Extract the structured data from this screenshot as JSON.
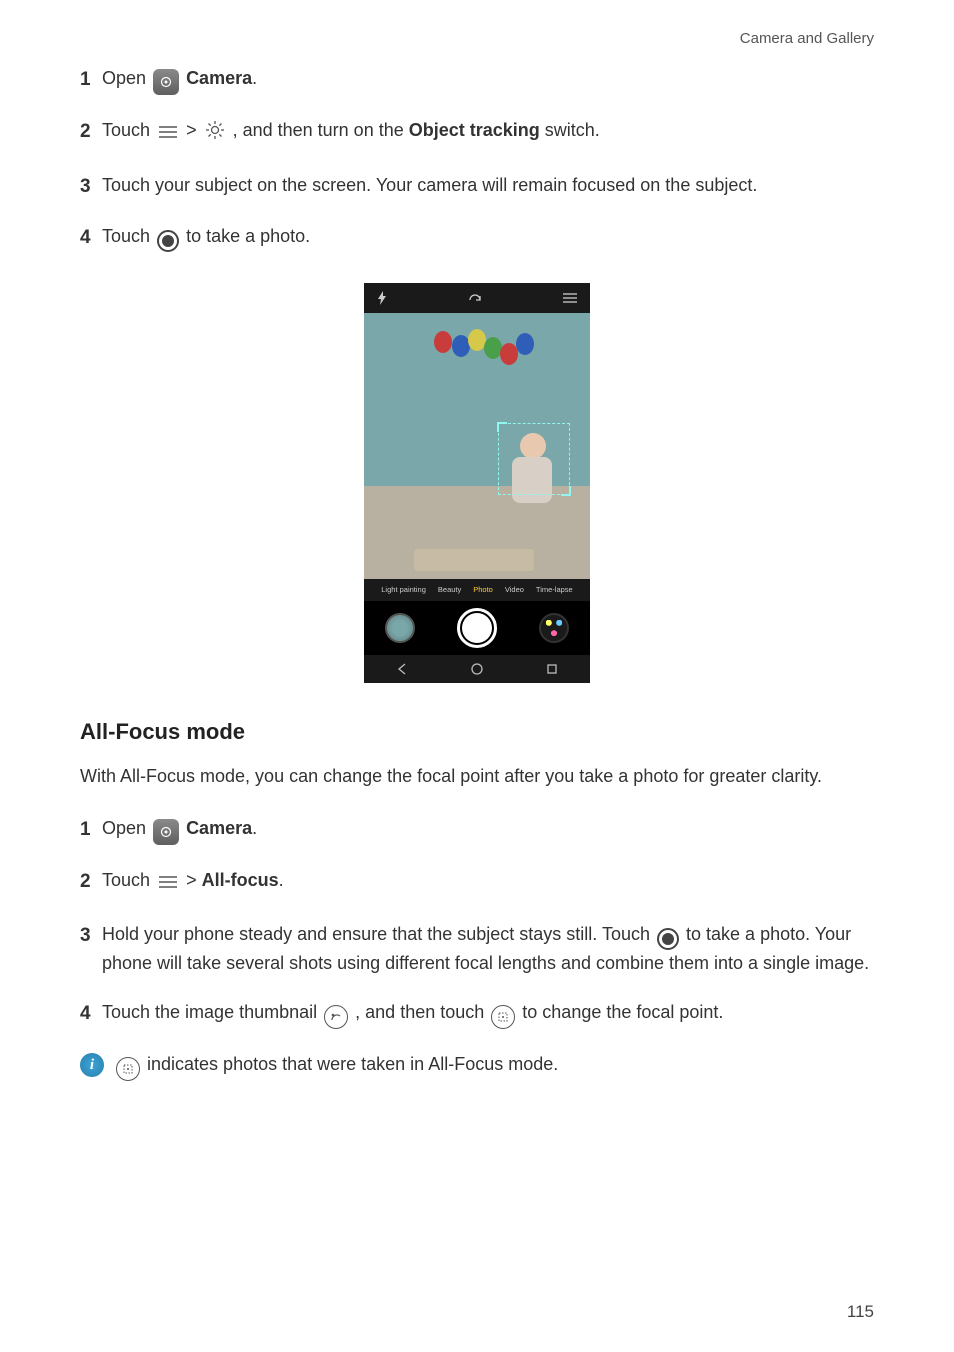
{
  "header": {
    "section_title": "Camera and Gallery"
  },
  "block_a": {
    "steps": [
      {
        "num": "1",
        "prefix": "Open ",
        "app_label": "Camera",
        "suffix": "."
      },
      {
        "num": "2",
        "prefix": "Touch ",
        "mid": " > ",
        "mid2": " , and then turn on the ",
        "feature": "Object tracking",
        "suffix": " switch."
      },
      {
        "num": "3",
        "text": "Touch your subject on the screen. Your camera will remain focused on the subject."
      },
      {
        "num": "4",
        "prefix": "Touch ",
        "suffix": " to take a photo."
      }
    ]
  },
  "phone_modes": {
    "m1": "Light painting",
    "m2": "Beauty",
    "m3": "Photo",
    "m4": "Video",
    "m5": "Time-lapse"
  },
  "section_b": {
    "heading": "All-Focus mode",
    "intro": "With All-Focus mode, you can change the focal point after you take a photo for greater clarity.",
    "steps": [
      {
        "num": "1",
        "prefix": "Open ",
        "app_label": "Camera",
        "suffix": "."
      },
      {
        "num": "2",
        "prefix": "Touch ",
        "mid": " > ",
        "feature": "All-focus",
        "suffix": "."
      },
      {
        "num": "3",
        "prefix": "Hold your phone steady and ensure that the subject stays still. Touch ",
        "suffix": " to take a photo. Your phone will take several shots using different focal lengths and combine them into a single image."
      },
      {
        "num": "4",
        "prefix": "Touch the image thumbnail ",
        "mid": " , and then touch ",
        "suffix": " to change the focal point."
      }
    ],
    "tip": {
      "text": " indicates photos that were taken in All-Focus mode."
    }
  },
  "page_number": "115"
}
